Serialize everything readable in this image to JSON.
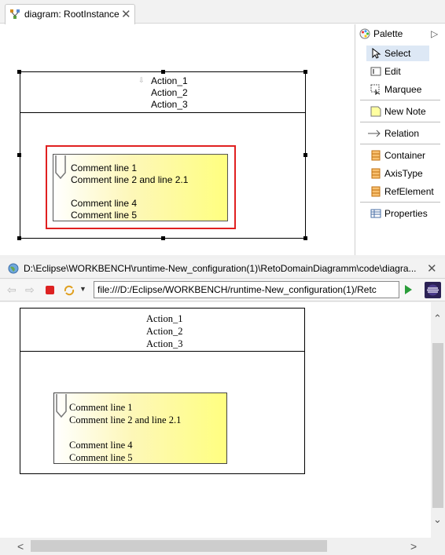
{
  "editor": {
    "tab_title": "diagram: RootInstance",
    "tab_close": "✕",
    "container_actions": [
      "Action_1",
      "Action_2",
      "Action_3"
    ],
    "note_lines": [
      "Comment line 1",
      "Comment line 2 and line 2.1",
      "",
      "Comment line 4",
      "Comment line 5"
    ]
  },
  "palette": {
    "title": "Palette",
    "items": [
      {
        "label": "Select",
        "icon": "arrow-pointer-icon",
        "selected": true
      },
      {
        "label": "Edit",
        "icon": "text-cursor-icon"
      },
      {
        "label": "Marquee",
        "icon": "marquee-icon"
      },
      {
        "label": "New Note",
        "icon": "note-icon"
      },
      {
        "label": "Relation",
        "icon": "arrow-right-icon"
      },
      {
        "label": "Container",
        "icon": "class-orange-icon"
      },
      {
        "label": "AxisType",
        "icon": "class-orange-icon"
      },
      {
        "label": "RefElement",
        "icon": "class-orange-icon"
      },
      {
        "label": "Properties",
        "icon": "table-icon"
      }
    ]
  },
  "browser": {
    "title": "D:\\Eclipse\\WORKBENCH\\runtime-New_configuration(1)\\RetoDomainDiagramm\\code\\diagra...",
    "close": "✕",
    "address": "file:///D:/Eclipse/WORKBENCH/runtime-New_configuration(1)/Retc",
    "page_actions": [
      "Action_1",
      "Action_2",
      "Action_3"
    ],
    "page_note_lines": [
      "Comment line 1",
      "Comment line 2 and line 2.1",
      "",
      "Comment line 4",
      "Comment line 5"
    ]
  },
  "colors": {
    "selection": "#e02020",
    "note_fill": "#ffff80",
    "palette_selected": "#dde8f5",
    "class_icon": "#f0a030",
    "go_button": "#2a9d3a",
    "stop_button": "#d22"
  }
}
